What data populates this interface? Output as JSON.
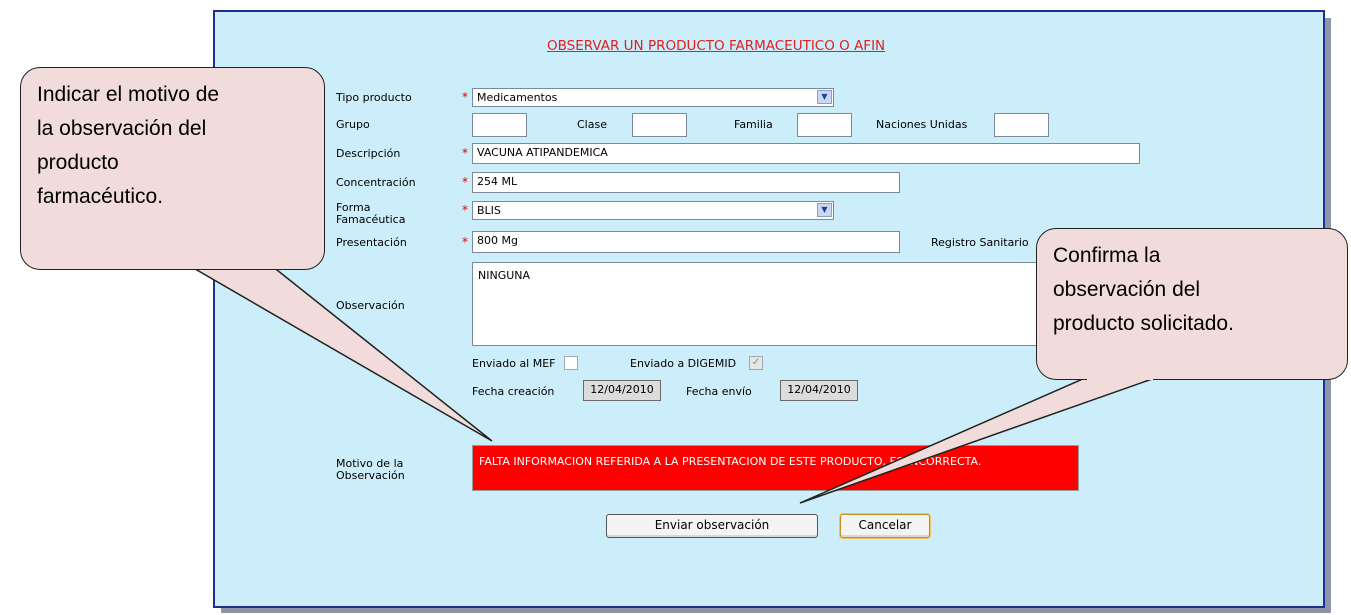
{
  "form": {
    "title": "OBSERVAR UN PRODUCTO FARMACEUTICO O AFIN",
    "required_mark": "*",
    "tipo_producto": {
      "label": "Tipo producto",
      "value": "Medicamentos"
    },
    "grupo": {
      "label": "Grupo",
      "value": ""
    },
    "clase": {
      "label": "Clase",
      "value": ""
    },
    "familia": {
      "label": "Familia",
      "value": ""
    },
    "naciones_unidas": {
      "label": "Naciones Unidas",
      "value": ""
    },
    "descripcion": {
      "label": "Descripción",
      "value": "VACUNA ATIPANDEMICA"
    },
    "concentracion": {
      "label": "Concentración",
      "value": "254 ML"
    },
    "forma_farmaceutica": {
      "label_line1": "Forma",
      "label_line2": "Famacéutica",
      "value": "BLIS"
    },
    "presentacion": {
      "label": "Presentación",
      "value": "800 Mg"
    },
    "registro_sanitario": {
      "label": "Registro Sanitario"
    },
    "observacion": {
      "label": "Observación",
      "value": "NINGUNA"
    },
    "enviado_mef": {
      "label": "Enviado al MEF",
      "checked": false
    },
    "enviado_digemid": {
      "label": "Enviado a DIGEMID",
      "checked": true
    },
    "fecha_creacion": {
      "label": "Fecha creación",
      "value": "12/04/2010"
    },
    "fecha_envio": {
      "label": "Fecha envío",
      "value": "12/04/2010"
    },
    "motivo": {
      "label_line1": "Motivo de la",
      "label_line2": "Observación",
      "value": "FALTA INFORMACION REFERIDA A LA PRESENTACION DE ESTE PRODUCTO, ES INCORRECTA.",
      "highlight_color": "#ff0000"
    },
    "buttons": {
      "enviar": "Enviar observación",
      "cancelar": "Cancelar"
    }
  },
  "callouts": {
    "left": {
      "lines": [
        "Indicar el motivo de",
        "la observación del",
        "producto",
        "farmacéutico."
      ]
    },
    "right": {
      "lines": [
        "Confirma la",
        "observación del",
        "producto solicitado."
      ]
    }
  },
  "icons": {
    "dropdown": "chevron-down-icon",
    "checkmark": "checkmark-icon"
  },
  "colors": {
    "form_bg": "#cceefa",
    "title": "#e02020",
    "callout_bg": "#f2dcdb",
    "motivo_bg": "#ff0000"
  }
}
